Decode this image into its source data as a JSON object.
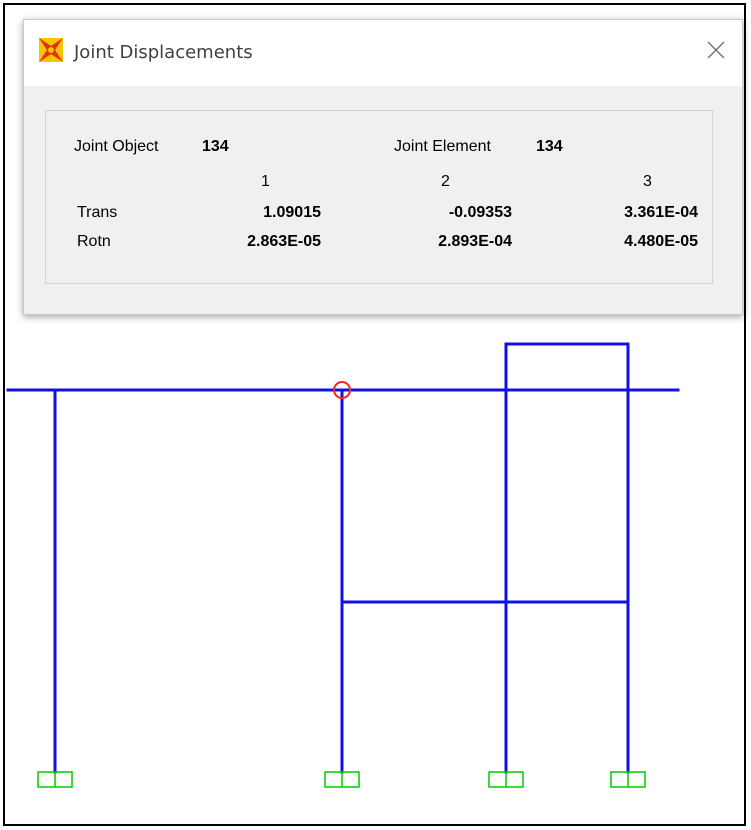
{
  "dialog": {
    "title": "Joint Displacements",
    "icon": "sap2000-app-icon",
    "close_icon": "close-icon"
  },
  "joint": {
    "object_label": "Joint Object",
    "object_value": "134",
    "element_label": "Joint Element",
    "element_value": "134"
  },
  "table": {
    "columns": [
      "1",
      "2",
      "3"
    ],
    "rows": [
      {
        "label": "Trans",
        "values": [
          "1.09015",
          "-0.09353",
          "3.361E-04"
        ]
      },
      {
        "label": "Rotn",
        "values": [
          "2.863E-05",
          "2.893E-04",
          "4.480E-05"
        ]
      }
    ]
  },
  "model_view": {
    "member_color": "#1010e6",
    "support_color": "#00cc00",
    "selected_joint_color": "#ff2020"
  }
}
